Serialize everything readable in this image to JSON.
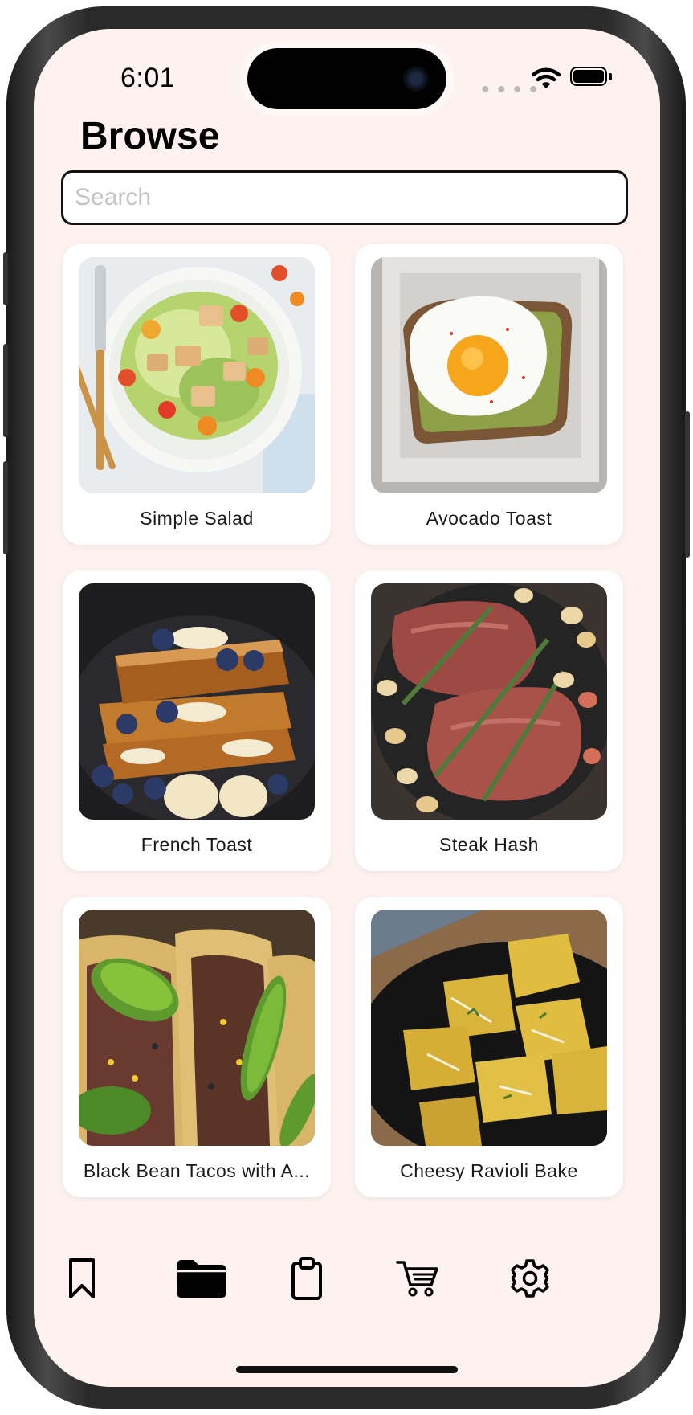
{
  "status_bar": {
    "time": "6:01"
  },
  "header": {
    "title": "Browse"
  },
  "search": {
    "placeholder": "Search",
    "value": ""
  },
  "recipes": [
    {
      "name": "Simple Salad"
    },
    {
      "name": "Avocado Toast"
    },
    {
      "name": "French Toast"
    },
    {
      "name": "Steak Hash"
    },
    {
      "name": "Black Bean Tacos with A..."
    },
    {
      "name": "Cheesy Ravioli Bake"
    }
  ],
  "tab_bar": {
    "active_tab": "browse",
    "tabs": [
      {
        "id": "saved",
        "icon": "bookmark-icon"
      },
      {
        "id": "browse",
        "icon": "folder-icon"
      },
      {
        "id": "list",
        "icon": "clipboard-icon"
      },
      {
        "id": "cart",
        "icon": "cart-icon"
      },
      {
        "id": "settings",
        "icon": "gear-icon"
      }
    ]
  },
  "colors": {
    "background": "#fdf2ef",
    "card": "#ffffff",
    "text": "#000000",
    "placeholder": "#c4c4c4"
  }
}
